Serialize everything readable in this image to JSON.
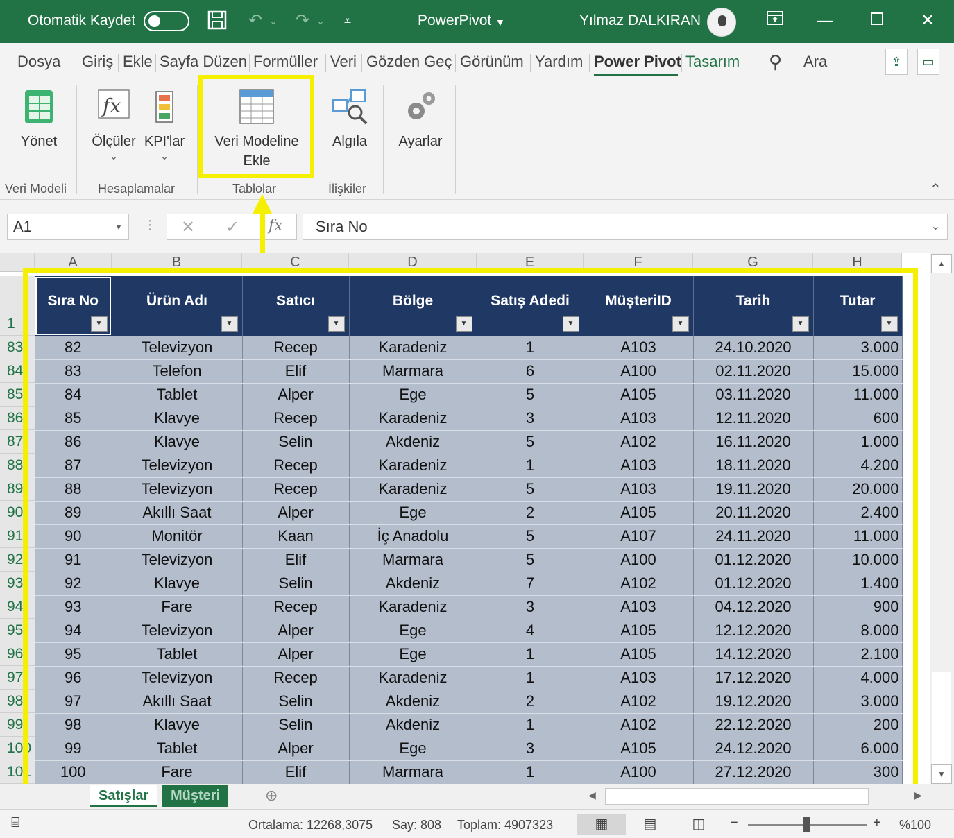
{
  "titlebar": {
    "autosave_label": "Otomatik Kaydet",
    "app_title": "PowerPivot",
    "user_name": "Yılmaz DALKIRAN"
  },
  "tabs": [
    "Dosya",
    "Giriş",
    "Ekle",
    "Sayfa Düzen",
    "Formüller",
    "Veri",
    "Gözden Geç",
    "Görünüm",
    "Yardım",
    "Power Pivot",
    "Tasarım"
  ],
  "active_tab": "Power Pivot",
  "search_label": "Ara",
  "ribbon": {
    "buttons": {
      "manage": "Yönet",
      "measures": "Ölçüler",
      "kpis": "KPI'lar",
      "add_model_line1": "Veri Modeline",
      "add_model_line2": "Ekle",
      "detect": "Algıla",
      "settings": "Ayarlar"
    },
    "groups": {
      "data_model": "Veri Modeli",
      "calculations": "Hesaplamalar",
      "tables": "Tablolar",
      "relationships": "İlişkiler"
    }
  },
  "formula_bar": {
    "name_box": "A1",
    "formula": "Sıra No",
    "fx": "fx"
  },
  "columns": [
    "A",
    "B",
    "C",
    "D",
    "E",
    "F",
    "G",
    "H"
  ],
  "header_row_number": "1",
  "row_numbers": [
    "83",
    "84",
    "85",
    "86",
    "87",
    "88",
    "89",
    "90",
    "91",
    "92",
    "93",
    "94",
    "95",
    "96",
    "97",
    "98",
    "99",
    "100",
    "101"
  ],
  "table": {
    "headers": [
      "Sıra No",
      "Ürün Adı",
      "Satıcı",
      "Bölge",
      "Satış Adedi",
      "MüşteriID",
      "Tarih",
      "Tutar"
    ],
    "rows": [
      [
        "82",
        "Televizyon",
        "Recep",
        "Karadeniz",
        "1",
        "A103",
        "24.10.2020",
        "3.000"
      ],
      [
        "83",
        "Telefon",
        "Elif",
        "Marmara",
        "6",
        "A100",
        "02.11.2020",
        "15.000"
      ],
      [
        "84",
        "Tablet",
        "Alper",
        "Ege",
        "5",
        "A105",
        "03.11.2020",
        "11.000"
      ],
      [
        "85",
        "Klavye",
        "Recep",
        "Karadeniz",
        "3",
        "A103",
        "12.11.2020",
        "600"
      ],
      [
        "86",
        "Klavye",
        "Selin",
        "Akdeniz",
        "5",
        "A102",
        "16.11.2020",
        "1.000"
      ],
      [
        "87",
        "Televizyon",
        "Recep",
        "Karadeniz",
        "1",
        "A103",
        "18.11.2020",
        "4.200"
      ],
      [
        "88",
        "Televizyon",
        "Recep",
        "Karadeniz",
        "5",
        "A103",
        "19.11.2020",
        "20.000"
      ],
      [
        "89",
        "Akıllı Saat",
        "Alper",
        "Ege",
        "2",
        "A105",
        "20.11.2020",
        "2.400"
      ],
      [
        "90",
        "Monitör",
        "Kaan",
        "İç Anadolu",
        "5",
        "A107",
        "24.11.2020",
        "11.000"
      ],
      [
        "91",
        "Televizyon",
        "Elif",
        "Marmara",
        "5",
        "A100",
        "01.12.2020",
        "10.000"
      ],
      [
        "92",
        "Klavye",
        "Selin",
        "Akdeniz",
        "7",
        "A102",
        "01.12.2020",
        "1.400"
      ],
      [
        "93",
        "Fare",
        "Recep",
        "Karadeniz",
        "3",
        "A103",
        "04.12.2020",
        "900"
      ],
      [
        "94",
        "Televizyon",
        "Alper",
        "Ege",
        "4",
        "A105",
        "12.12.2020",
        "8.000"
      ],
      [
        "95",
        "Tablet",
        "Alper",
        "Ege",
        "1",
        "A105",
        "14.12.2020",
        "2.100"
      ],
      [
        "96",
        "Televizyon",
        "Recep",
        "Karadeniz",
        "1",
        "A103",
        "17.12.2020",
        "4.000"
      ],
      [
        "97",
        "Akıllı Saat",
        "Selin",
        "Akdeniz",
        "2",
        "A102",
        "19.12.2020",
        "3.000"
      ],
      [
        "98",
        "Klavye",
        "Selin",
        "Akdeniz",
        "1",
        "A102",
        "22.12.2020",
        "200"
      ],
      [
        "99",
        "Tablet",
        "Alper",
        "Ege",
        "3",
        "A105",
        "24.12.2020",
        "6.000"
      ],
      [
        "100",
        "Fare",
        "Elif",
        "Marmara",
        "1",
        "A100",
        "27.12.2020",
        "300"
      ]
    ]
  },
  "sheet_tabs": [
    "Satışlar",
    "Müşteri"
  ],
  "statusbar": {
    "average": "Ortalama: 12268,3075",
    "count": "Say: 808",
    "sum": "Toplam: 4907323",
    "zoom": "%100"
  },
  "colors": {
    "excel_green": "#217346",
    "table_header": "#203864",
    "table_body": "#b4bdcc",
    "highlight": "#f5f000"
  }
}
